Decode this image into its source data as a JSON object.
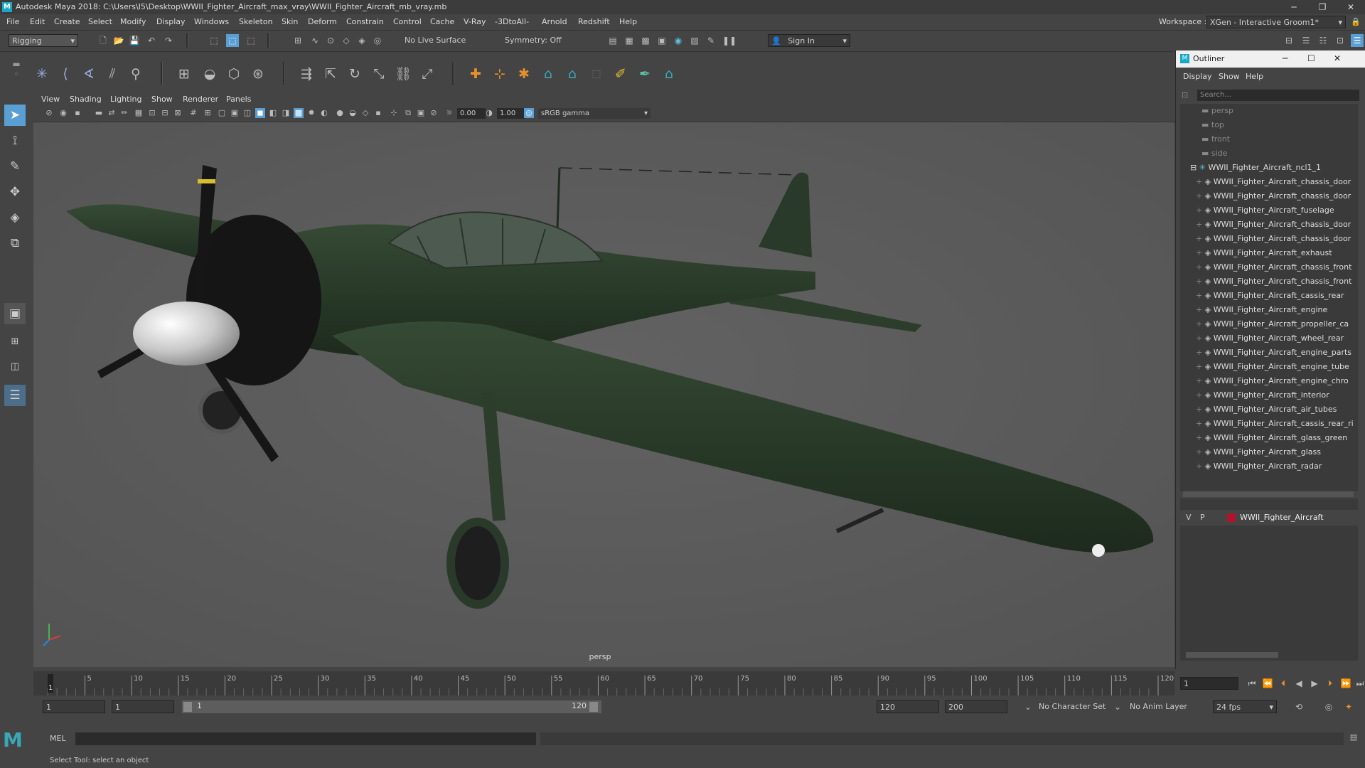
{
  "window": {
    "title": "Autodesk Maya 2018: C:\\Users\\I5\\Desktop\\WWII_Fighter_Aircraft_max_vray\\WWII_Fighter_Aircraft_mb_vray.mb",
    "minimize": "─",
    "restore": "❐",
    "close": "✕"
  },
  "menus": [
    "File",
    "Edit",
    "Create",
    "Select",
    "Modify",
    "Display",
    "Windows",
    "Skeleton",
    "Skin",
    "Deform",
    "Constrain",
    "Control",
    "Cache",
    "V-Ray",
    "-3DtoAll-",
    "Arnold",
    "Redshift",
    "Help"
  ],
  "workspace": {
    "label": "Workspace :",
    "value": "XGen - Interactive Groom1*"
  },
  "status": {
    "mode": "Rigging",
    "live_surface": "No Live Surface",
    "symmetry": "Symmetry: Off",
    "sign_in": "Sign In"
  },
  "viewport": {
    "menus": [
      "View",
      "Shading",
      "Lighting",
      "Show",
      "Renderer",
      "Panels"
    ],
    "exposure": "0.00",
    "gamma": "1.00",
    "colorspace": "sRGB gamma",
    "camera_label": "persp"
  },
  "outliner": {
    "title": "Outliner",
    "menus": [
      "Display",
      "Show",
      "Help"
    ],
    "search_placeholder": "Search...",
    "cameras": [
      "persp",
      "top",
      "front",
      "side"
    ],
    "group": "WWII_Fighter_Aircraft_ncl1_1",
    "items": [
      "WWII_Fighter_Aircraft_chassis_door",
      "WWII_Fighter_Aircraft_chassis_door",
      "WWII_Fighter_Aircraft_fuselage",
      "WWII_Fighter_Aircraft_chassis_door",
      "WWII_Fighter_Aircraft_chassis_door",
      "WWII_Fighter_Aircraft_exhaust",
      "WWII_Fighter_Aircraft_chassis_front",
      "WWII_Fighter_Aircraft_chassis_front",
      "WWII_Fighter_Aircraft_cassis_rear",
      "WWII_Fighter_Aircraft_engine",
      "WWII_Fighter_Aircraft_propeller_ca",
      "WWII_Fighter_Aircraft_wheel_rear",
      "WWII_Fighter_Aircraft_engine_parts",
      "WWII_Fighter_Aircraft_engine_tube",
      "WWII_Fighter_Aircraft_engine_chro",
      "WWII_Fighter_Aircraft_interior",
      "WWII_Fighter_Aircraft_air_tubes",
      "WWII_Fighter_Aircraft_cassis_rear_ri",
      "WWII_Fighter_Aircraft_glass_green",
      "WWII_Fighter_Aircraft_glass",
      "WWII_Fighter_Aircraft_radar"
    ],
    "layer": {
      "v": "V",
      "p": "P",
      "name": "WWII_Fighter_Aircraft",
      "color": "#b0142a"
    }
  },
  "timeline": {
    "ticks": [
      "5",
      "10",
      "15",
      "20",
      "25",
      "30",
      "35",
      "40",
      "45",
      "50",
      "55",
      "60",
      "65",
      "70",
      "75",
      "80",
      "85",
      "90",
      "95",
      "100",
      "105",
      "110",
      "115",
      "120"
    ],
    "start_marker": "1",
    "current_frame": "1"
  },
  "range": {
    "start": "1",
    "playback_start": "1",
    "slider_start": "1",
    "slider_end": "120",
    "playback_end": "120",
    "end": "200",
    "character_set": "No Character Set",
    "anim_layer": "No Anim Layer",
    "fps": "24 fps"
  },
  "command": {
    "language": "MEL"
  },
  "help_line": "Select Tool: select an object",
  "colors": {
    "accent": "#5a9fd4",
    "aircraft": "#2c3d2c"
  }
}
